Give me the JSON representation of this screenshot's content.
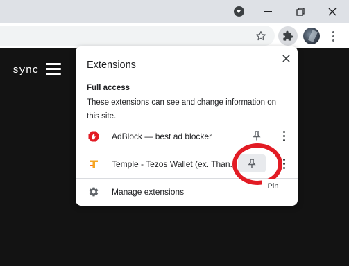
{
  "window": {
    "tab_search_icon": "tab-search-icon",
    "minimize_icon": "minimize-icon",
    "restore_icon": "restore-icon",
    "close_icon": "close-icon"
  },
  "toolbar": {
    "bookmark_icon": "star-icon",
    "extensions_icon": "puzzle-icon",
    "menu_icon": "more-vert-icon"
  },
  "page": {
    "logo_text": "sync"
  },
  "popup": {
    "title": "Extensions",
    "section_title": "Full access",
    "section_description": "These extensions can see and change information on this site.",
    "extensions": [
      {
        "name": "AdBlock — best ad blocker",
        "icon": "adblock-icon",
        "color": "#e21b24"
      },
      {
        "name": "Temple - Tezos Wallet (ex. Than...",
        "icon": "temple-icon",
        "color": "#f5a623"
      }
    ],
    "manage_label": "Manage extensions",
    "tooltip": "Pin"
  },
  "colors": {
    "titlebar": "#dee1e6",
    "page_background": "#131313",
    "annotation": "#e21b24"
  }
}
